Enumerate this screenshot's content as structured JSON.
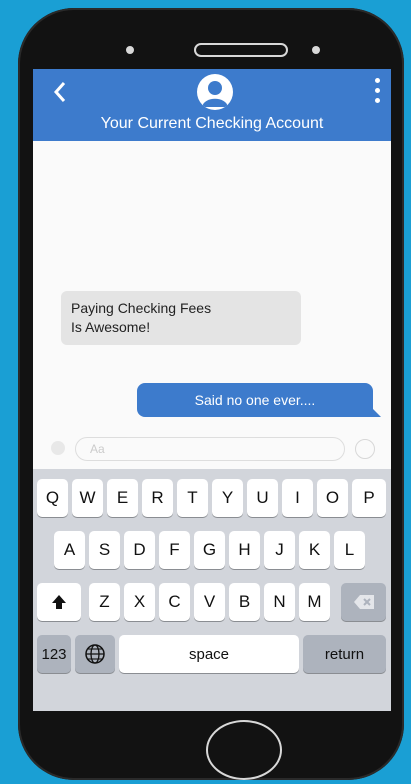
{
  "header": {
    "title": "Your Current Checking Account",
    "back_icon": "chevron-left-icon",
    "avatar_icon": "user-icon",
    "menu_icon": "vertical-ellipsis-icon",
    "color": "#3d7bcc"
  },
  "messages": {
    "incoming": {
      "line1": "Paying Checking Fees",
      "line2": "Is Awesome!"
    },
    "outgoing": {
      "text": "Said no one ever...."
    }
  },
  "composer": {
    "placeholder": "Aa"
  },
  "keyboard": {
    "row1": [
      "Q",
      "W",
      "E",
      "R",
      "T",
      "Y",
      "U",
      "I",
      "O",
      "P"
    ],
    "row2": [
      "A",
      "S",
      "D",
      "F",
      "G",
      "H",
      "J",
      "K",
      "L"
    ],
    "row3": [
      "Z",
      "X",
      "C",
      "V",
      "B",
      "N",
      "M"
    ],
    "numbers_label": "123",
    "space_label": "space",
    "return_label": "return",
    "shift_icon": "shift-arrow-icon",
    "delete_icon": "backspace-icon",
    "globe_icon": "globe-icon"
  }
}
